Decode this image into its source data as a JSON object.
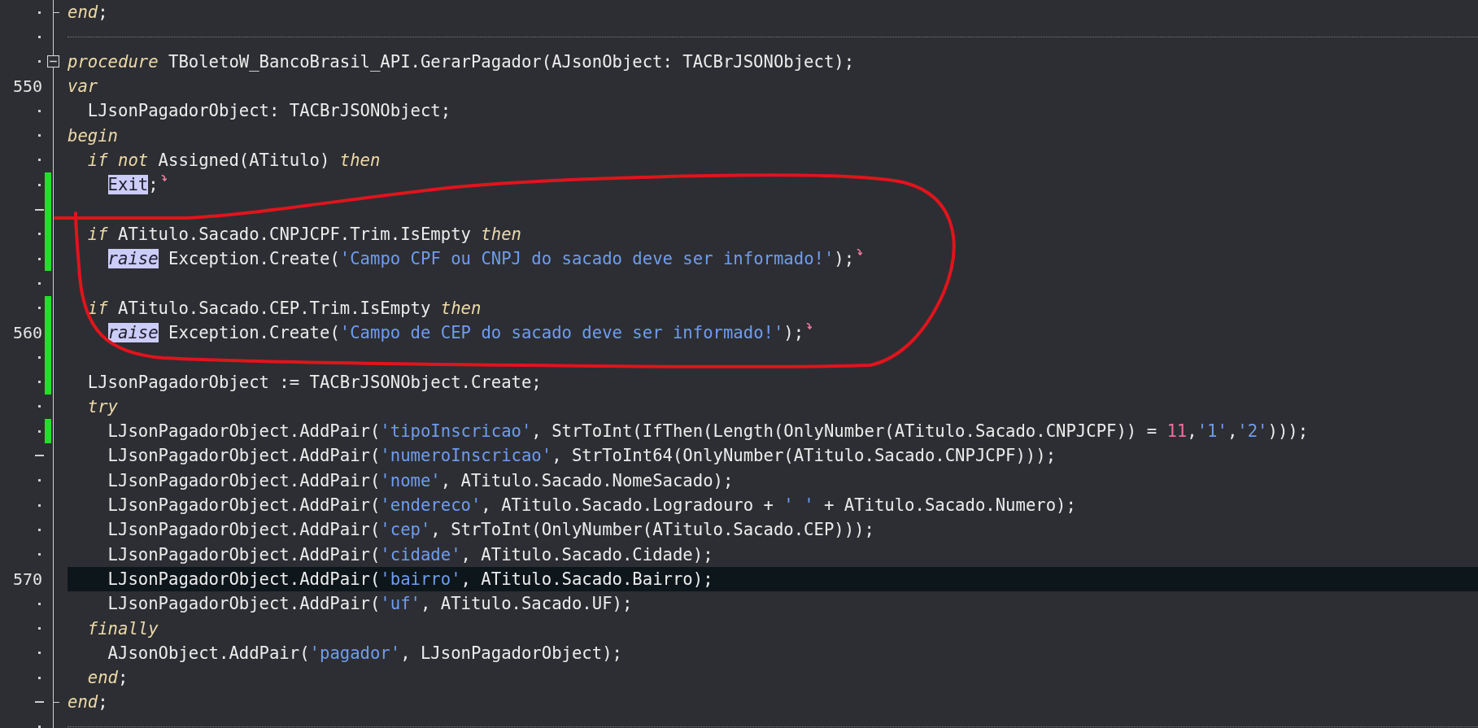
{
  "editor": {
    "lines": [
      {
        "kind": "code",
        "gutter": {
          "kind": "dot"
        },
        "changed": false,
        "current": false,
        "fold_start": false,
        "fold_end": true,
        "flow_mark": false,
        "tokens": [
          {
            "kind": "keyword",
            "text": "end"
          },
          {
            "kind": "plain",
            "text": ";"
          }
        ]
      },
      {
        "kind": "separator",
        "gutter": {
          "kind": "dot"
        },
        "changed": false,
        "current": false,
        "fold_start": false,
        "fold_end": false,
        "flow_mark": false
      },
      {
        "kind": "code",
        "gutter": {
          "kind": "dot"
        },
        "changed": false,
        "current": false,
        "fold_start": true,
        "fold_end": false,
        "flow_mark": false,
        "tokens": [
          {
            "kind": "keyword",
            "text": "procedure"
          },
          {
            "kind": "plain",
            "text": " TBoletoW_BancoBrasil_API.GerarPagador(AJsonObject: TACBrJSONObject);"
          }
        ]
      },
      {
        "kind": "code",
        "gutter": {
          "kind": "number",
          "text": "550"
        },
        "changed": false,
        "current": false,
        "fold_start": false,
        "fold_end": false,
        "flow_mark": false,
        "tokens": [
          {
            "kind": "keyword",
            "text": "var"
          }
        ]
      },
      {
        "kind": "code",
        "gutter": {
          "kind": "dot"
        },
        "changed": false,
        "current": false,
        "fold_start": false,
        "fold_end": false,
        "flow_mark": false,
        "tokens": [
          {
            "kind": "plain",
            "text": "  LJsonPagadorObject: TACBrJSONObject;"
          }
        ]
      },
      {
        "kind": "code",
        "gutter": {
          "kind": "dot"
        },
        "changed": false,
        "current": false,
        "fold_start": false,
        "fold_end": false,
        "flow_mark": false,
        "tokens": [
          {
            "kind": "keyword",
            "text": "begin"
          }
        ]
      },
      {
        "kind": "code",
        "gutter": {
          "kind": "dot"
        },
        "changed": false,
        "current": false,
        "fold_start": false,
        "fold_end": false,
        "flow_mark": false,
        "tokens": [
          {
            "kind": "keyword",
            "text": "  if not"
          },
          {
            "kind": "plain",
            "text": " Assigned(ATitulo) "
          },
          {
            "kind": "keyword",
            "text": "then"
          }
        ]
      },
      {
        "kind": "code",
        "gutter": {
          "kind": "dot"
        },
        "changed": true,
        "current": false,
        "fold_start": false,
        "fold_end": false,
        "flow_mark": true,
        "tokens": [
          {
            "kind": "marked-plain",
            "text": "    Exit"
          },
          {
            "kind": "plain",
            "text": ";"
          }
        ]
      },
      {
        "kind": "code",
        "gutter": {
          "kind": "dash"
        },
        "changed": true,
        "current": false,
        "fold_start": false,
        "fold_end": false,
        "flow_mark": false
      },
      {
        "kind": "code",
        "gutter": {
          "kind": "dot"
        },
        "changed": true,
        "current": false,
        "fold_start": false,
        "fold_end": false,
        "flow_mark": false,
        "tokens": [
          {
            "kind": "keyword",
            "text": "  if"
          },
          {
            "kind": "plain",
            "text": " ATitulo.Sacado.CNPJCPF.Trim.IsEmpty "
          },
          {
            "kind": "keyword",
            "text": "then"
          }
        ]
      },
      {
        "kind": "code",
        "gutter": {
          "kind": "dot"
        },
        "changed": true,
        "current": false,
        "fold_start": false,
        "fold_end": false,
        "flow_mark": true,
        "tokens": [
          {
            "kind": "marked-keyword",
            "text": "    raise"
          },
          {
            "kind": "plain",
            "text": " Exception.Create("
          },
          {
            "kind": "string",
            "text": "'Campo CPF ou CNPJ do sacado deve ser informado!'"
          },
          {
            "kind": "plain",
            "text": ");"
          }
        ]
      },
      {
        "kind": "code",
        "gutter": {
          "kind": "dot"
        },
        "changed": false,
        "current": false,
        "fold_start": false,
        "fold_end": false,
        "flow_mark": false
      },
      {
        "kind": "code",
        "gutter": {
          "kind": "dot"
        },
        "changed": true,
        "current": false,
        "fold_start": false,
        "fold_end": false,
        "flow_mark": false,
        "tokens": [
          {
            "kind": "keyword",
            "text": "  if"
          },
          {
            "kind": "plain",
            "text": " ATitulo.Sacado.CEP.Trim.IsEmpty "
          },
          {
            "kind": "keyword",
            "text": "then"
          }
        ]
      },
      {
        "kind": "code",
        "gutter": {
          "kind": "number",
          "text": "560"
        },
        "changed": true,
        "current": false,
        "fold_start": false,
        "fold_end": false,
        "flow_mark": true,
        "tokens": [
          {
            "kind": "marked-keyword",
            "text": "    raise"
          },
          {
            "kind": "plain",
            "text": " Exception.Create("
          },
          {
            "kind": "string",
            "text": "'Campo de CEP do sacado deve ser informado!'"
          },
          {
            "kind": "plain",
            "text": ");"
          }
        ]
      },
      {
        "kind": "code",
        "gutter": {
          "kind": "dot"
        },
        "changed": true,
        "current": false,
        "fold_start": false,
        "fold_end": false,
        "flow_mark": false
      },
      {
        "kind": "code",
        "gutter": {
          "kind": "dot"
        },
        "changed": true,
        "current": false,
        "fold_start": false,
        "fold_end": false,
        "flow_mark": false,
        "tokens": [
          {
            "kind": "plain",
            "text": "  LJsonPagadorObject := TACBrJSONObject.Create;"
          }
        ]
      },
      {
        "kind": "code",
        "gutter": {
          "kind": "dot"
        },
        "changed": false,
        "current": false,
        "fold_start": false,
        "fold_end": false,
        "flow_mark": false,
        "tokens": [
          {
            "kind": "keyword",
            "text": "  try"
          }
        ]
      },
      {
        "kind": "code",
        "gutter": {
          "kind": "dot"
        },
        "changed": true,
        "current": false,
        "fold_start": false,
        "fold_end": false,
        "flow_mark": false,
        "tokens": [
          {
            "kind": "plain",
            "text": "    LJsonPagadorObject.AddPair("
          },
          {
            "kind": "string",
            "text": "'tipoInscricao'"
          },
          {
            "kind": "plain",
            "text": ", StrToInt(IfThen(Length(OnlyNumber(ATitulo.Sacado.CNPJCPF)) = "
          },
          {
            "kind": "number",
            "text": "11"
          },
          {
            "kind": "plain",
            "text": ","
          },
          {
            "kind": "string",
            "text": "'1'"
          },
          {
            "kind": "plain",
            "text": ","
          },
          {
            "kind": "string",
            "text": "'2'"
          },
          {
            "kind": "plain",
            "text": ")));"
          }
        ]
      },
      {
        "kind": "code",
        "gutter": {
          "kind": "dash"
        },
        "changed": false,
        "current": false,
        "fold_start": false,
        "fold_end": false,
        "flow_mark": false,
        "tokens": [
          {
            "kind": "plain",
            "text": "    LJsonPagadorObject.AddPair("
          },
          {
            "kind": "string",
            "text": "'numeroInscricao'"
          },
          {
            "kind": "plain",
            "text": ", StrToInt64(OnlyNumber(ATitulo.Sacado.CNPJCPF)));"
          }
        ]
      },
      {
        "kind": "code",
        "gutter": {
          "kind": "dot"
        },
        "changed": false,
        "current": false,
        "fold_start": false,
        "fold_end": false,
        "flow_mark": false,
        "tokens": [
          {
            "kind": "plain",
            "text": "    LJsonPagadorObject.AddPair("
          },
          {
            "kind": "string",
            "text": "'nome'"
          },
          {
            "kind": "plain",
            "text": ", ATitulo.Sacado.NomeSacado);"
          }
        ]
      },
      {
        "kind": "code",
        "gutter": {
          "kind": "dot"
        },
        "changed": false,
        "current": false,
        "fold_start": false,
        "fold_end": false,
        "flow_mark": false,
        "tokens": [
          {
            "kind": "plain",
            "text": "    LJsonPagadorObject.AddPair("
          },
          {
            "kind": "string",
            "text": "'endereco'"
          },
          {
            "kind": "plain",
            "text": ", ATitulo.Sacado.Logradouro + "
          },
          {
            "kind": "string",
            "text": "' '"
          },
          {
            "kind": "plain",
            "text": " + ATitulo.Sacado.Numero);"
          }
        ]
      },
      {
        "kind": "code",
        "gutter": {
          "kind": "dot"
        },
        "changed": false,
        "current": false,
        "fold_start": false,
        "fold_end": false,
        "flow_mark": false,
        "tokens": [
          {
            "kind": "plain",
            "text": "    LJsonPagadorObject.AddPair("
          },
          {
            "kind": "string",
            "text": "'cep'"
          },
          {
            "kind": "plain",
            "text": ", StrToInt(OnlyNumber(ATitulo.Sacado.CEP)));"
          }
        ]
      },
      {
        "kind": "code",
        "gutter": {
          "kind": "dot"
        },
        "changed": false,
        "current": false,
        "fold_start": false,
        "fold_end": false,
        "flow_mark": false,
        "tokens": [
          {
            "kind": "plain",
            "text": "    LJsonPagadorObject.AddPair("
          },
          {
            "kind": "string",
            "text": "'cidade'"
          },
          {
            "kind": "plain",
            "text": ", ATitulo.Sacado.Cidade);"
          }
        ]
      },
      {
        "kind": "code",
        "gutter": {
          "kind": "number",
          "text": "570"
        },
        "changed": false,
        "current": true,
        "fold_start": false,
        "fold_end": false,
        "flow_mark": false,
        "tokens": [
          {
            "kind": "plain",
            "text": "    LJsonPagadorObject.AddPair("
          },
          {
            "kind": "string",
            "text": "'bairro'"
          },
          {
            "kind": "plain",
            "text": ", ATitulo.Sacado.Bairro);"
          }
        ]
      },
      {
        "kind": "code",
        "gutter": {
          "kind": "dot"
        },
        "changed": false,
        "current": false,
        "fold_start": false,
        "fold_end": false,
        "flow_mark": false,
        "tokens": [
          {
            "kind": "plain",
            "text": "    LJsonPagadorObject.AddPair("
          },
          {
            "kind": "string",
            "text": "'uf'"
          },
          {
            "kind": "plain",
            "text": ", ATitulo.Sacado.UF);"
          }
        ]
      },
      {
        "kind": "code",
        "gutter": {
          "kind": "dot"
        },
        "changed": false,
        "current": false,
        "fold_start": false,
        "fold_end": false,
        "flow_mark": false,
        "tokens": [
          {
            "kind": "keyword",
            "text": "  finally"
          }
        ]
      },
      {
        "kind": "code",
        "gutter": {
          "kind": "dot"
        },
        "changed": false,
        "current": false,
        "fold_start": false,
        "fold_end": false,
        "flow_mark": false,
        "tokens": [
          {
            "kind": "plain",
            "text": "    AJsonObject.AddPair("
          },
          {
            "kind": "string",
            "text": "'pagador'"
          },
          {
            "kind": "plain",
            "text": ", LJsonPagadorObject);"
          }
        ]
      },
      {
        "kind": "code",
        "gutter": {
          "kind": "dot"
        },
        "changed": false,
        "current": false,
        "fold_start": false,
        "fold_end": false,
        "flow_mark": false,
        "tokens": [
          {
            "kind": "keyword",
            "text": "  end"
          },
          {
            "kind": "plain",
            "text": ";"
          }
        ]
      },
      {
        "kind": "code",
        "gutter": {
          "kind": "dash"
        },
        "changed": false,
        "current": false,
        "fold_start": false,
        "fold_end": true,
        "flow_mark": false,
        "tokens": [
          {
            "kind": "keyword",
            "text": "end"
          },
          {
            "kind": "plain",
            "text": ";"
          }
        ]
      },
      {
        "kind": "separator",
        "gutter": {
          "kind": "dot"
        },
        "changed": false,
        "current": false,
        "fold_start": false,
        "fold_end": false,
        "flow_mark": false
      }
    ]
  }
}
